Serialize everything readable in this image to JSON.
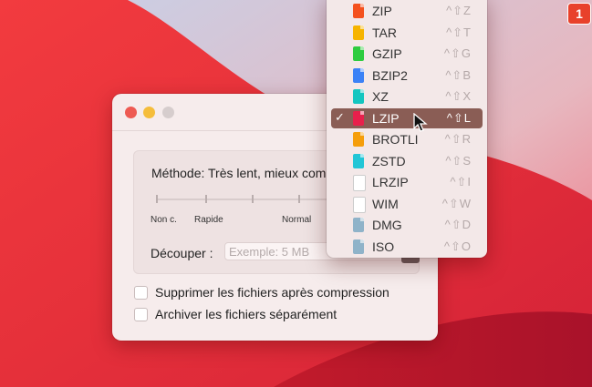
{
  "badge": "1",
  "colors": {
    "wallpaper_red": "#e5303a",
    "menu_selected": "#8a5d55"
  },
  "window": {
    "method_label": "Méthode: Très lent, mieux com",
    "slider_ticks": [
      "Non c.",
      "Rapide",
      "Normal"
    ],
    "split_label": "Découper :",
    "split_placeholder": "Exemple: 5 MB",
    "checkbox_delete": "Supprimer les fichiers après compression",
    "checkbox_separate": "Archiver les fichiers séparément"
  },
  "menu": {
    "items": [
      {
        "label": "ZIP",
        "shortcut": "^⇧Z",
        "icon": "zip-file-icon",
        "color": "#f4511e"
      },
      {
        "label": "TAR",
        "shortcut": "^⇧T",
        "icon": "tar-file-icon",
        "color": "#f6b400"
      },
      {
        "label": "GZIP",
        "shortcut": "^⇧G",
        "icon": "gzip-file-icon",
        "color": "#2ecc40"
      },
      {
        "label": "BZIP2",
        "shortcut": "^⇧B",
        "icon": "bzip2-file-icon",
        "color": "#3b82f6"
      },
      {
        "label": "XZ",
        "shortcut": "^⇧X",
        "icon": "xz-file-icon",
        "color": "#14c6c0"
      },
      {
        "label": "LZIP",
        "shortcut": "^⇧L",
        "icon": "lzip-file-icon",
        "color": "#e8204c",
        "selected": true
      },
      {
        "label": "BROTLI",
        "shortcut": "^⇧R",
        "icon": "brotli-file-icon",
        "color": "#f59e0b"
      },
      {
        "label": "ZSTD",
        "shortcut": "^⇧S",
        "icon": "zstd-file-icon",
        "color": "#22c6d6"
      },
      {
        "label": "LRZIP",
        "shortcut": "^⇧I",
        "icon": "lrzip-file-icon",
        "color": "#ffffff"
      },
      {
        "label": "WIM",
        "shortcut": "^⇧W",
        "icon": "wim-file-icon",
        "color": "#ffffff"
      },
      {
        "label": "DMG",
        "shortcut": "^⇧D",
        "icon": "dmg-disk-icon",
        "color": "#8fb3c9"
      },
      {
        "label": "ISO",
        "shortcut": "^⇧O",
        "icon": "iso-disk-icon",
        "color": "#8fb3c9"
      }
    ]
  }
}
